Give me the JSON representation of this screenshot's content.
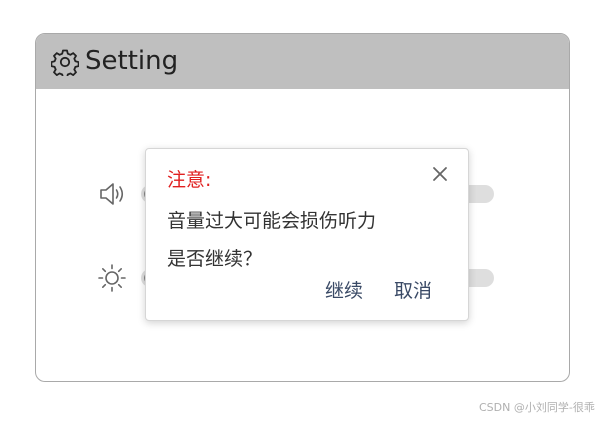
{
  "window": {
    "title": "Setting",
    "title_icon": "gear-icon"
  },
  "settings": {
    "volume": {
      "icon": "speaker-icon"
    },
    "brightness": {
      "icon": "sun-icon"
    }
  },
  "dialog": {
    "title": "注意:",
    "message_line1": "音量过大可能会损伤听力",
    "message_line2": "是否继续？",
    "continue_label": "继续",
    "cancel_label": "取消",
    "close_icon": "close-icon"
  },
  "watermark": "CSDN @小刘同学-很乖",
  "colors": {
    "header_bg": "#bfbfbf",
    "dialog_title": "#e02020",
    "button_text": "#3a4a66"
  }
}
